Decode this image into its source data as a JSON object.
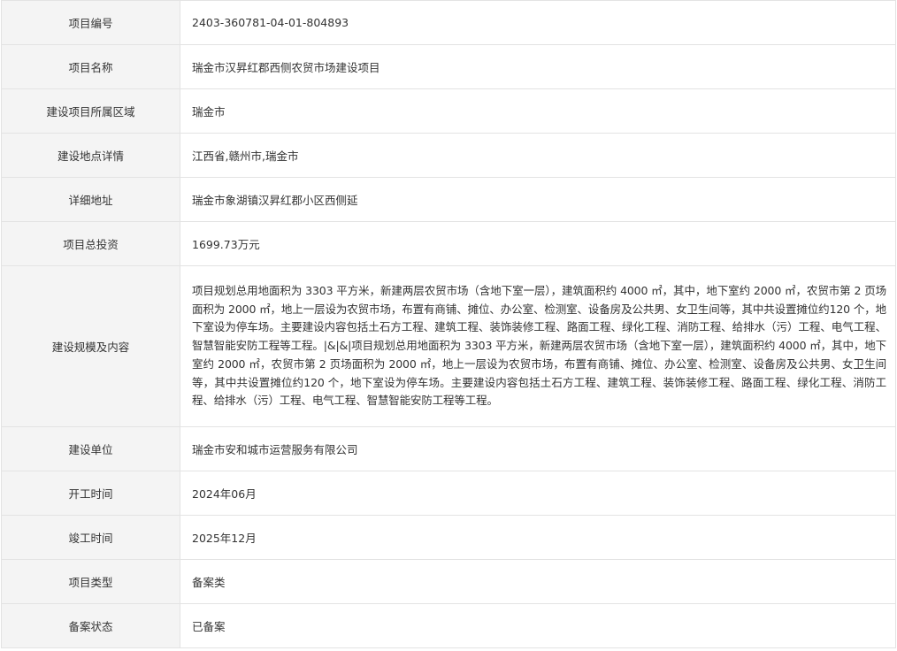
{
  "rows": [
    {
      "label": "项目编号",
      "value": "2403-360781-04-01-804893"
    },
    {
      "label": "项目名称",
      "value": "瑞金市汉昇红郡西侧农贸市场建设项目"
    },
    {
      "label": "建设项目所属区域",
      "value": "瑞金市"
    },
    {
      "label": "建设地点详情",
      "value": "江西省,赣州市,瑞金市"
    },
    {
      "label": "详细地址",
      "value": "瑞金市象湖镇汉昇红郡小区西侧延"
    },
    {
      "label": "项目总投资",
      "value": "1699.73万元"
    },
    {
      "label": "建设规模及内容",
      "value": "项目规划总用地面积为 3303 平方米，新建两层农贸市场（含地下室一层），建筑面积约 4000 ㎡，其中，地下室约 2000 ㎡，农贸市第 2 页场面积为 2000 ㎡，地上一层设为农贸市场，布置有商铺、摊位、办公室、检测室、设备房及公共男、女卫生间等，其中共设置摊位约120 个，地下室设为停车场。主要建设内容包括土石方工程、建筑工程、装饰装修工程、路面工程、绿化工程、消防工程、给排水（污）工程、电气工程、智慧智能安防工程等工程。|&|&|项目规划总用地面积为 3303 平方米，新建两层农贸市场（含地下室一层），建筑面积约 4000 ㎡，其中，地下室约 2000 ㎡，农贸市第 2 页场面积为 2000 ㎡，地上一层设为农贸市场，布置有商铺、摊位、办公室、检测室、设备房及公共男、女卫生间等，其中共设置摊位约120 个，地下室设为停车场。主要建设内容包括土石方工程、建筑工程、装饰装修工程、路面工程、绿化工程、消防工程、给排水（污）工程、电气工程、智慧智能安防工程等工程。"
    },
    {
      "label": "建设单位",
      "value": "瑞金市安和城市运营服务有限公司"
    },
    {
      "label": "开工时间",
      "value": "2024年06月"
    },
    {
      "label": "竣工时间",
      "value": "2025年12月"
    },
    {
      "label": "项目类型",
      "value": "备案类"
    },
    {
      "label": "备案状态",
      "value": "已备案"
    }
  ]
}
